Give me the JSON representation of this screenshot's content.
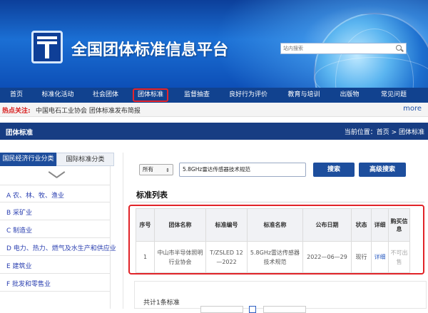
{
  "header": {
    "site_title": "全国团体标准信息平台",
    "search_placeholder": "站内搜索"
  },
  "nav": {
    "items": [
      {
        "label": "首页"
      },
      {
        "label": "标准化活动"
      },
      {
        "label": "社会团体"
      },
      {
        "label": "团体标准"
      },
      {
        "label": "监督抽查"
      },
      {
        "label": "良好行为评价"
      },
      {
        "label": "教育与培训"
      },
      {
        "label": "出版物"
      },
      {
        "label": "常见问题"
      }
    ],
    "active": "团体标准"
  },
  "hot": {
    "label": "热点关注:",
    "text": "中国电石工业协会 团体标准发布简报",
    "more": "more"
  },
  "section": {
    "title": "团体标准",
    "breadcrumb": "当前位置：首页 > 团体标准"
  },
  "sidebar": {
    "tabs": [
      {
        "label": "国民经济行业分类"
      },
      {
        "label": "国际标准分类"
      }
    ],
    "categories": [
      {
        "label": "A 农、林、牧、渔业"
      },
      {
        "label": "B 采矿业"
      },
      {
        "label": "C 制造业"
      },
      {
        "label": "D 电力、热力、燃气及水生产和供应业"
      },
      {
        "label": "E 建筑业"
      },
      {
        "label": "F 批发和零售业"
      }
    ]
  },
  "search": {
    "select_value": "所有",
    "query": "5.8GHz雷达传感器技术规范",
    "search_label": "搜索",
    "advanced_label": "高级搜索"
  },
  "list": {
    "title": "标准列表",
    "headers": [
      "序号",
      "团体名称",
      "标准编号",
      "标准名称",
      "公布日期",
      "状态",
      "详细",
      "购买信息"
    ],
    "rows": [
      {
        "index": "1",
        "org": "中山市半导体照明行业协会",
        "code": "T/ZSLED 12—2022",
        "name": "5.8GHz雷达传感器技术规范",
        "date": "2022—06—29",
        "status": "现行",
        "detail": "详细",
        "purchase": "不可出售"
      }
    ]
  },
  "pager": {
    "total": "共计1条标准"
  }
}
